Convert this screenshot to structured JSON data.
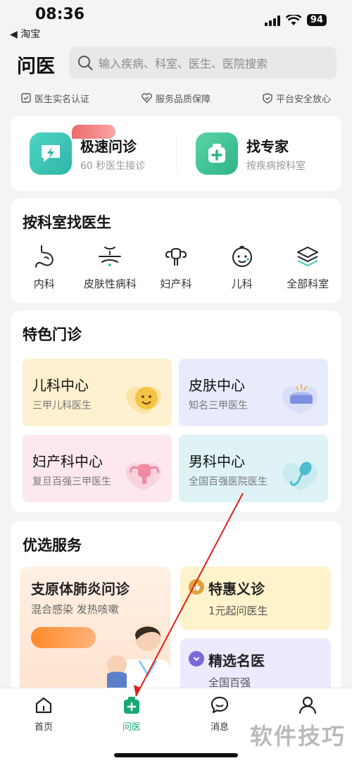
{
  "status_bar": {
    "time": "08:36",
    "back_app": "◀ 淘宝",
    "battery": "94"
  },
  "header": {
    "title": "问医",
    "search_placeholder": "输入疾病、科室、医生、医院搜索"
  },
  "trust": [
    "医生实名认证",
    "服务品质保障",
    "平台安全放心"
  ],
  "quick": [
    {
      "title": "极速问诊",
      "subtitle": "60 秒医生接诊",
      "icon": "lightning-chat-icon"
    },
    {
      "title": "找专家",
      "subtitle": "按疾病按科室",
      "icon": "medical-kit-icon"
    }
  ],
  "departments": {
    "title": "按科室找医生",
    "items": [
      {
        "label": "内科",
        "icon": "stomach-icon"
      },
      {
        "label": "皮肤性病科",
        "icon": "skin-icon"
      },
      {
        "label": "妇产科",
        "icon": "uterus-icon"
      },
      {
        "label": "儿科",
        "icon": "baby-face-icon"
      },
      {
        "label": "全部科室",
        "icon": "layers-icon"
      }
    ]
  },
  "special": {
    "title": "特色门诊",
    "items": [
      {
        "title": "儿科中心",
        "subtitle": "三甲儿科医生",
        "bg": "#fdf1cf"
      },
      {
        "title": "皮肤中心",
        "subtitle": "知名三甲医生",
        "bg": "#e8ebfb"
      },
      {
        "title": "妇产科中心",
        "subtitle": "复旦百强三甲医生",
        "bg": "#fde8ee"
      },
      {
        "title": "男科中心",
        "subtitle": "全国百强医院医生",
        "bg": "#dff3f6"
      }
    ]
  },
  "preferred": {
    "title": "优选服务",
    "main": {
      "title": "支原体肺炎问诊",
      "subtitle": "混合感染 发热咳嗽"
    },
    "side": [
      {
        "title": "特惠义诊",
        "subtitle": "1元起问医生",
        "bg": "#fff3cc",
        "icon_color": "#e2a23a"
      },
      {
        "title": "精选名医",
        "subtitle": "全国百强",
        "bg": "#eceafe",
        "icon_color": "#7a6ad8"
      }
    ]
  },
  "tabbar": [
    {
      "label": "首页",
      "icon": "home-icon"
    },
    {
      "label": "问医",
      "icon": "medical-case-icon"
    },
    {
      "label": "消息",
      "icon": "message-icon"
    },
    {
      "label": "",
      "icon": "profile-icon"
    }
  ],
  "watermark": "软件技巧",
  "colors": {
    "accent_green": "#1aa872",
    "quick_teal": "#3ec9b8"
  }
}
